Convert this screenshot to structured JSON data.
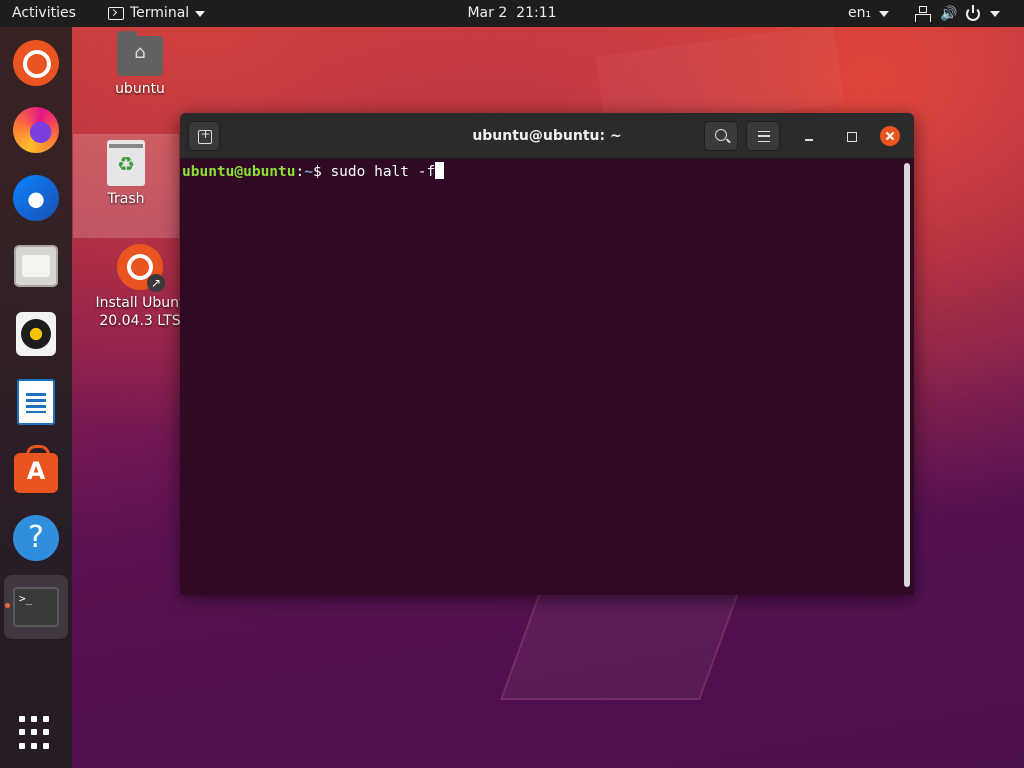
{
  "topbar": {
    "activities": "Activities",
    "app_name": "Terminal",
    "date": "Mar 2",
    "time": "21:11",
    "language": "en₁"
  },
  "dock": {
    "items": [
      "ubuntu-software-launcher",
      "firefox",
      "thunderbird",
      "files",
      "rhythmbox",
      "libreoffice-writer",
      "ubuntu-software",
      "help",
      "terminal"
    ],
    "terminal_glyph": ">_"
  },
  "desktop": {
    "home_label": "ubuntu",
    "trash_label": "Trash",
    "install_label_line1": "Install Ubunt",
    "install_label_line2": "20.04.3 LTS"
  },
  "terminal": {
    "title": "ubuntu@ubuntu: ~",
    "prompt_user": "ubuntu@ubuntu",
    "prompt_sep": ":",
    "prompt_path": "~",
    "prompt_symbol": "$ ",
    "command": "sudo halt -f"
  },
  "colors": {
    "accent": "#e95420",
    "terminal_bg": "#300a24",
    "prompt_user": "#8ae234",
    "prompt_path": "#729fcf"
  }
}
